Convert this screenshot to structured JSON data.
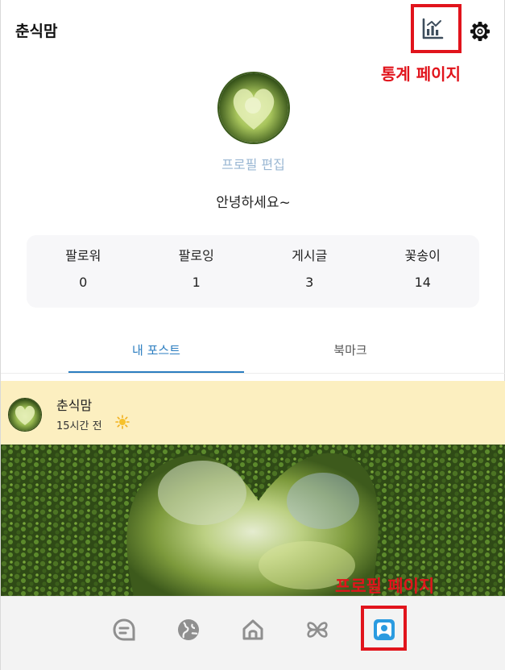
{
  "header": {
    "title": "춘식맘",
    "stats_icon": "stats-chart-icon",
    "settings_icon": "gear-icon"
  },
  "annotations": {
    "stats_page": "통계 페이지",
    "profile_page": "프로필 페이지",
    "color": "#e1141c"
  },
  "profile": {
    "edit_label": "프로필 편집",
    "bio": "안녕하세요~",
    "stats": [
      {
        "label": "팔로워",
        "value": "0"
      },
      {
        "label": "팔로잉",
        "value": "1"
      },
      {
        "label": "게시글",
        "value": "3"
      },
      {
        "label": "꽃송이",
        "value": "14"
      }
    ]
  },
  "tabs": {
    "my_posts": "내 포스트",
    "bookmarks": "북마크",
    "active_color": "#2b7dc0"
  },
  "post": {
    "author": "춘식맘",
    "time": "15시간 전",
    "weather_icon": "sun-icon",
    "background": "#fcefc0"
  },
  "bottom_nav": {
    "items": [
      {
        "icon": "chat-icon"
      },
      {
        "icon": "globe-icon"
      },
      {
        "icon": "home-icon"
      },
      {
        "icon": "flower-icon"
      },
      {
        "icon": "profile-icon",
        "active": true
      }
    ],
    "active_color": "#2b9be0"
  }
}
